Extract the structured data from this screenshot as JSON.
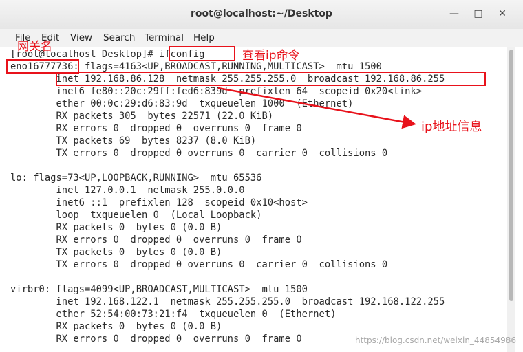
{
  "window": {
    "title": "root@localhost:~/Desktop"
  },
  "menu": [
    "File",
    "Edit",
    "View",
    "Search",
    "Terminal",
    "Help"
  ],
  "terminal": {
    "lines": [
      "[root@localhost Desktop]# ifconfig",
      "eno16777736: flags=4163<UP,BROADCAST,RUNNING,MULTICAST>  mtu 1500",
      "        inet 192.168.86.128  netmask 255.255.255.0  broadcast 192.168.86.255",
      "        inet6 fe80::20c:29ff:fed6:839d  prefixlen 64  scopeid 0x20<link>",
      "        ether 00:0c:29:d6:83:9d  txqueuelen 1000  (Ethernet)",
      "        RX packets 305  bytes 22571 (22.0 KiB)",
      "        RX errors 0  dropped 0  overruns 0  frame 0",
      "        TX packets 69  bytes 8237 (8.0 KiB)",
      "        TX errors 0  dropped 0 overruns 0  carrier 0  collisions 0",
      "",
      "lo: flags=73<UP,LOOPBACK,RUNNING>  mtu 65536",
      "        inet 127.0.0.1  netmask 255.0.0.0",
      "        inet6 ::1  prefixlen 128  scopeid 0x10<host>",
      "        loop  txqueuelen 0  (Local Loopback)",
      "        RX packets 0  bytes 0 (0.0 B)",
      "        RX errors 0  dropped 0  overruns 0  frame 0",
      "        TX packets 0  bytes 0 (0.0 B)",
      "        TX errors 0  dropped 0 overruns 0  carrier 0  collisions 0",
      "",
      "virbr0: flags=4099<UP,BROADCAST,MULTICAST>  mtu 1500",
      "        inet 192.168.122.1  netmask 255.255.255.0  broadcast 192.168.122.255",
      "        ether 52:54:00:73:21:f4  txqueuelen 0  (Ethernet)",
      "        RX packets 0  bytes 0 (0.0 B)",
      "        RX errors 0  dropped 0  overruns 0  frame 0"
    ]
  },
  "annotations": {
    "gateway_name": "网关名",
    "ip_command": "查看ip命令",
    "ip_info": "ip地址信息",
    "accent_color": "#e8121b"
  },
  "watermark": "https://blog.csdn.net/weixin_44854986"
}
